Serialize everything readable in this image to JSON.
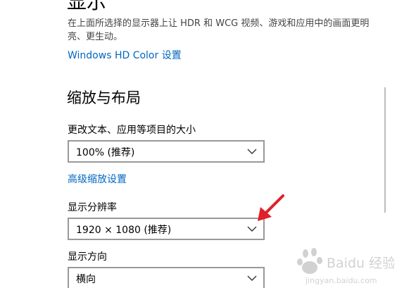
{
  "header": {
    "title": "显示",
    "description": "在上面所选择的显示器上让 HDR 和 WCG 视频、游戏和应用中的画面更明亮、更生动。",
    "hd_color_link": "Windows HD Color 设置"
  },
  "scale_layout": {
    "title": "缩放与布局",
    "text_size_label": "更改文本、应用等项目的大小",
    "text_size_value": "100% (推荐)",
    "advanced_scaling_link": "高级缩放设置",
    "resolution_label": "显示分辨率",
    "resolution_value": "1920 × 1080 (推荐)",
    "orientation_label": "显示方向",
    "orientation_value": "横向"
  },
  "watermark": {
    "text": "Baidu 经验",
    "url": "jingyan.baidu.com"
  },
  "colors": {
    "link": "#0067c0",
    "annotation_arrow": "#e0202a",
    "dropdown_border": "#999999"
  },
  "icons": {
    "dropdown": "chevron-down-icon",
    "annotation": "red-arrow-annotation"
  }
}
